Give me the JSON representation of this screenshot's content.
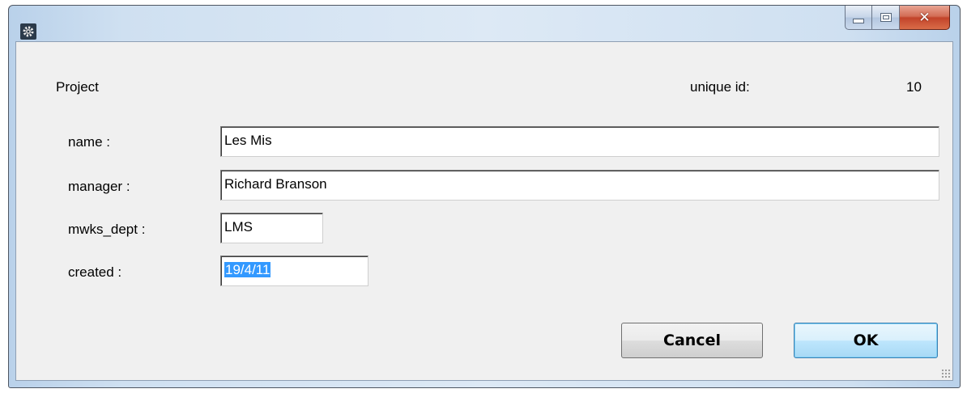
{
  "window": {
    "title": "",
    "icon": "gear-icon",
    "controls": {
      "minimize": "minimize-icon",
      "maximize": "maximize-icon",
      "close": "✕"
    }
  },
  "form": {
    "section_title": "Project",
    "unique_id_label": "unique id:",
    "unique_id_value": "10",
    "fields": [
      {
        "label": "name :",
        "value": "Les Mis"
      },
      {
        "label": "manager :",
        "value": "Richard Branson"
      },
      {
        "label": "mwks_dept :",
        "value": "LMS"
      },
      {
        "label": "created :",
        "value": "19/4/11",
        "selected": true
      }
    ]
  },
  "buttons": {
    "cancel": "Cancel",
    "ok": "OK"
  },
  "colors": {
    "selection": "#3399ff",
    "close_button": "#c2432a",
    "titlebar": "#cfe0f1"
  }
}
